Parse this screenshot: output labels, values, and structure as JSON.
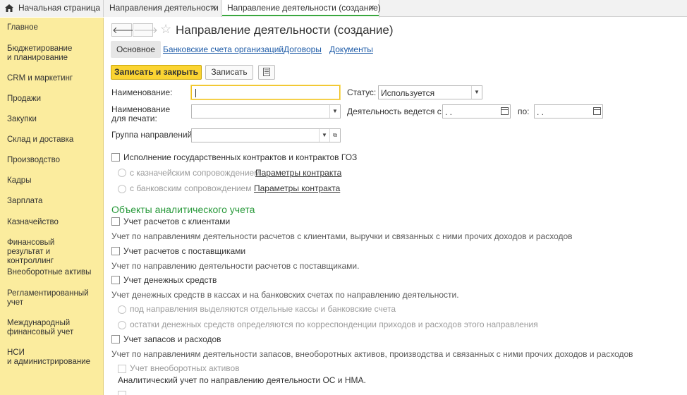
{
  "tabs": {
    "home": "Начальная страница",
    "directions": "Направления деятельности",
    "new": "Направление деятельности (создание)",
    "close_glyph": "×"
  },
  "sidebar": {
    "items": [
      "Главное",
      "Бюджетирование\nи планирование",
      "CRM и маркетинг",
      "Продажи",
      "Закупки",
      "Склад и доставка",
      "Производство",
      "Кадры",
      "Зарплата",
      "Казначейство",
      "Финансовый\nрезультат и контроллинг",
      "Внеоборотные активы",
      "Регламентированный\nучет",
      "Международный\nфинансовый учет",
      "НСИ\nи администрирование"
    ]
  },
  "header": {
    "back_glyph": "🡐",
    "forward_glyph": "🡒",
    "star_glyph": "☆",
    "title": "Направление деятельности (создание)"
  },
  "subtabs": {
    "main": "Основное",
    "bank_accounts": "Банковские счета организаций",
    "contracts": "Договоры",
    "documents": "Документы"
  },
  "toolbar": {
    "save_close": "Записать и закрыть",
    "save": "Записать"
  },
  "form": {
    "name_label": "Наименование:",
    "name_value": "",
    "status_label": "Статус:",
    "status_value": "Используется",
    "print_name_label": "Наименование\nдля печати:",
    "print_name_value": "",
    "active_from_label": "Деятельность ведется с:",
    "active_from_value": " .  .",
    "to_label": "по:",
    "to_value": " .  .",
    "group_label": "Группа направлений:",
    "group_value": "",
    "gov_contracts": "Исполнение государственных контрактов и контрактов ГОЗ",
    "treasury_support": "с казначейским сопровождением",
    "bank_support": "с банковским сопровождением",
    "contract_params_1": "Параметры контракта",
    "contract_params_2": "Параметры контракта"
  },
  "analytics": {
    "title": "Объекты аналитического учета",
    "clients": "Учет расчетов с клиентами",
    "clients_hint": "Учет по направлениям деятельности расчетов с клиентами, выручки и связанных с ними прочих доходов и расходов",
    "suppliers": "Учет расчетов с поставщиками",
    "suppliers_hint": "Учет по направлению деятельности расчетов с поставщиками.",
    "cash": "Учет денежных средств",
    "cash_hint": "Учет денежных средств в кассах и на банковских счетах по направлению деятельности.",
    "cash_opt1": "под направления выделяются отдельные кассы и банковские счета",
    "cash_opt2": "остатки денежных средств определяются по корреспонденции приходов и расходов этого направления",
    "inventory": "Учет запасов и расходов",
    "inventory_hint": "Учет по направлениям деятельности запасов, внеоборотных активов, производства и связанных с ними прочих доходов и расходов",
    "fixed_assets": "Учет внеоборотных активов",
    "fixed_assets_hint": "Аналитический учет по направлению деятельности ОС и НМА."
  },
  "colors": {
    "accent_yellow": "#fbd432",
    "sidebar_bg": "#fbec9e",
    "section_green": "#2a9a3c",
    "link_blue": "#1f5ca8"
  }
}
